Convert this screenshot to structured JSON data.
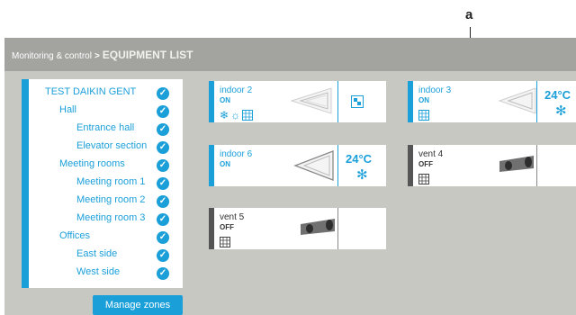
{
  "callout": "a",
  "breadcrumb": {
    "parent": "Monitoring & control",
    "separator": ">",
    "current": "EQUIPMENT LIST"
  },
  "tree": {
    "items": [
      {
        "label": "TEST DAIKIN GENT"
      },
      {
        "label": "Hall"
      },
      {
        "label": "Entrance hall"
      },
      {
        "label": "Elevator section"
      },
      {
        "label": "Meeting rooms"
      },
      {
        "label": "Meeting room 1"
      },
      {
        "label": "Meeting room 2"
      },
      {
        "label": "Meeting room 3"
      },
      {
        "label": "Offices"
      },
      {
        "label": "East side"
      },
      {
        "label": "West side"
      }
    ],
    "check_icon": "checkmark-icon"
  },
  "manage_zones_label": "Manage zones",
  "cards": [
    {
      "name": "indoor 2",
      "status": "ON",
      "unit": "ceiling-cassette",
      "icons": [
        "snowflake-icon",
        "sun-icon",
        "grid-icon"
      ],
      "side_icon": "remote-icon"
    },
    {
      "name": "indoor 3",
      "status": "ON",
      "unit": "ceiling-cassette",
      "icons": [
        "grid-icon"
      ],
      "temperature": "24°C",
      "mode_icon": "snowflake-icon"
    },
    {
      "name": "indoor 6",
      "status": "ON",
      "unit": "ceiling-cassette",
      "temperature": "24°C",
      "mode_icon": "snowflake-icon"
    },
    {
      "name": "vent 4",
      "status": "OFF",
      "unit": "ventilation-duct",
      "icons": [
        "grid-icon"
      ]
    },
    {
      "name": "vent 5",
      "status": "OFF",
      "unit": "ventilation-duct",
      "icons": [
        "grid-icon"
      ]
    }
  ],
  "colors": {
    "accent": "#1a9fd9",
    "panel": "#c8c8c3",
    "topbar": "#a3a3a0",
    "off": "#555555"
  }
}
